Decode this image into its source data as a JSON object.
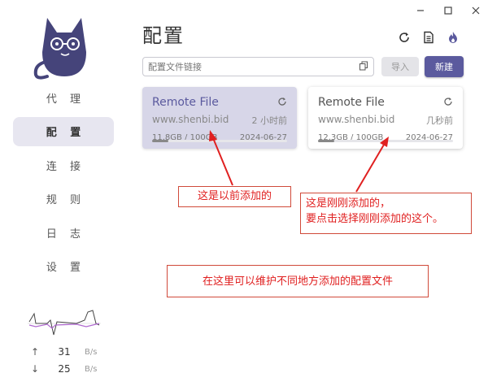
{
  "window": {
    "controls": [
      "minimize-icon",
      "maximize-icon",
      "close-icon"
    ]
  },
  "sidebar": {
    "items": [
      {
        "label": "代 理"
      },
      {
        "label": "配 置",
        "active": true
      },
      {
        "label": "连 接"
      },
      {
        "label": "规 则"
      },
      {
        "label": "日 志"
      },
      {
        "label": "设 置"
      }
    ],
    "traffic": {
      "up_value": "31",
      "up_unit": "B/s",
      "down_value": "25",
      "down_unit": "B/s"
    }
  },
  "main": {
    "title": "配置",
    "header_icons": [
      "refresh-icon",
      "document-icon",
      "fire-icon"
    ],
    "url_input": {
      "placeholder": "配置文件链接",
      "value": ""
    },
    "import_label": "导入",
    "new_label": "新建",
    "profiles": [
      {
        "name": "Remote File",
        "url": "www.shenbi.bid",
        "updated": "2 小时前",
        "usage": "11.8GB / 100GB",
        "date": "2024-06-27",
        "usage_fraction": 0.118,
        "selected": true
      },
      {
        "name": "Remote File",
        "url": "www.shenbi.bid",
        "updated": "几秒前",
        "usage": "12.3GB / 100GB",
        "date": "2024-06-27",
        "usage_fraction": 0.123,
        "selected": false
      }
    ]
  },
  "annotations": {
    "note1": "这是以前添加的",
    "note2_line1": "这是刚刚添加的，",
    "note2_line2": "要点击选择刚刚添加的这个。",
    "note3": "在这里可以维护不同地方添加的配置文件"
  },
  "colors": {
    "accent": "#5b5a9e",
    "selected_card": "#d7d6e8",
    "annotation": "#e02020"
  }
}
